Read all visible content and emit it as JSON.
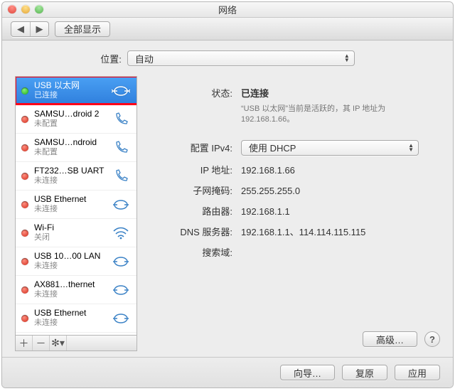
{
  "window": {
    "title": "网络"
  },
  "toolbar": {
    "show_all": "全部显示"
  },
  "location": {
    "label": "位置:",
    "value": "自动"
  },
  "sidebar": {
    "items": [
      {
        "name": "USB 以太网",
        "status": "已连接",
        "dot": "green",
        "icon": "ethernet",
        "selected": true
      },
      {
        "name": "SAMSU…droid 2",
        "status": "未配置",
        "dot": "red",
        "icon": "phone"
      },
      {
        "name": "SAMSU…ndroid",
        "status": "未配置",
        "dot": "red",
        "icon": "phone"
      },
      {
        "name": "FT232…SB UART",
        "status": "未连接",
        "dot": "red",
        "icon": "phone"
      },
      {
        "name": "USB Ethernet",
        "status": "未连接",
        "dot": "red",
        "icon": "ethernet"
      },
      {
        "name": "Wi-Fi",
        "status": "关闭",
        "dot": "red",
        "icon": "wifi"
      },
      {
        "name": "USB 10…00 LAN",
        "status": "未连接",
        "dot": "red",
        "icon": "ethernet"
      },
      {
        "name": "AX881…thernet",
        "status": "未连接",
        "dot": "red",
        "icon": "ethernet"
      },
      {
        "name": "USB Ethernet",
        "status": "未连接",
        "dot": "red",
        "icon": "ethernet"
      }
    ]
  },
  "details": {
    "status_label": "状态:",
    "status_value": "已连接",
    "status_desc": "“USB 以太网”当前是活跃的，其 IP 地址为 192.168.1.66。",
    "config_label": "配置 IPv4:",
    "config_value": "使用 DHCP",
    "ip_label": "IP 地址:",
    "ip_value": "192.168.1.66",
    "mask_label": "子网掩码:",
    "mask_value": "255.255.255.0",
    "router_label": "路由器:",
    "router_value": "192.168.1.1",
    "dns_label": "DNS 服务器:",
    "dns_value": "192.168.1.1、114.114.115.115",
    "search_label": "搜索域:",
    "search_value": "",
    "advanced": "高级…"
  },
  "footer": {
    "assist": "向导…",
    "revert": "复原",
    "apply": "应用"
  }
}
